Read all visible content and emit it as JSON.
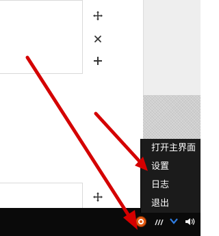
{
  "canvas": {
    "top_toolbar_icons": [
      "move-icon",
      "close-icon",
      "add-icon"
    ],
    "bottom_toolbar_icons": [
      "move-icon"
    ]
  },
  "tray_menu": {
    "items": [
      {
        "label": "打开主界面"
      },
      {
        "label": "设置"
      },
      {
        "label": "日志"
      },
      {
        "label": "退出"
      }
    ]
  },
  "taskbar": {
    "tray_icons": [
      "app-tray-icon",
      "network-icon",
      "chevron-down-icon",
      "speaker-icon"
    ]
  },
  "annotations": {
    "arrow_color": "#d40000",
    "arrows": [
      "arrow-to-settings",
      "arrow-to-tray-icon"
    ]
  },
  "colors": {
    "menu_background": "#1b1b1b",
    "taskbar_background": "#0a0a0a",
    "tray_icon_orange": "#e25a13",
    "tray_chevron_blue": "#2f7de1"
  }
}
